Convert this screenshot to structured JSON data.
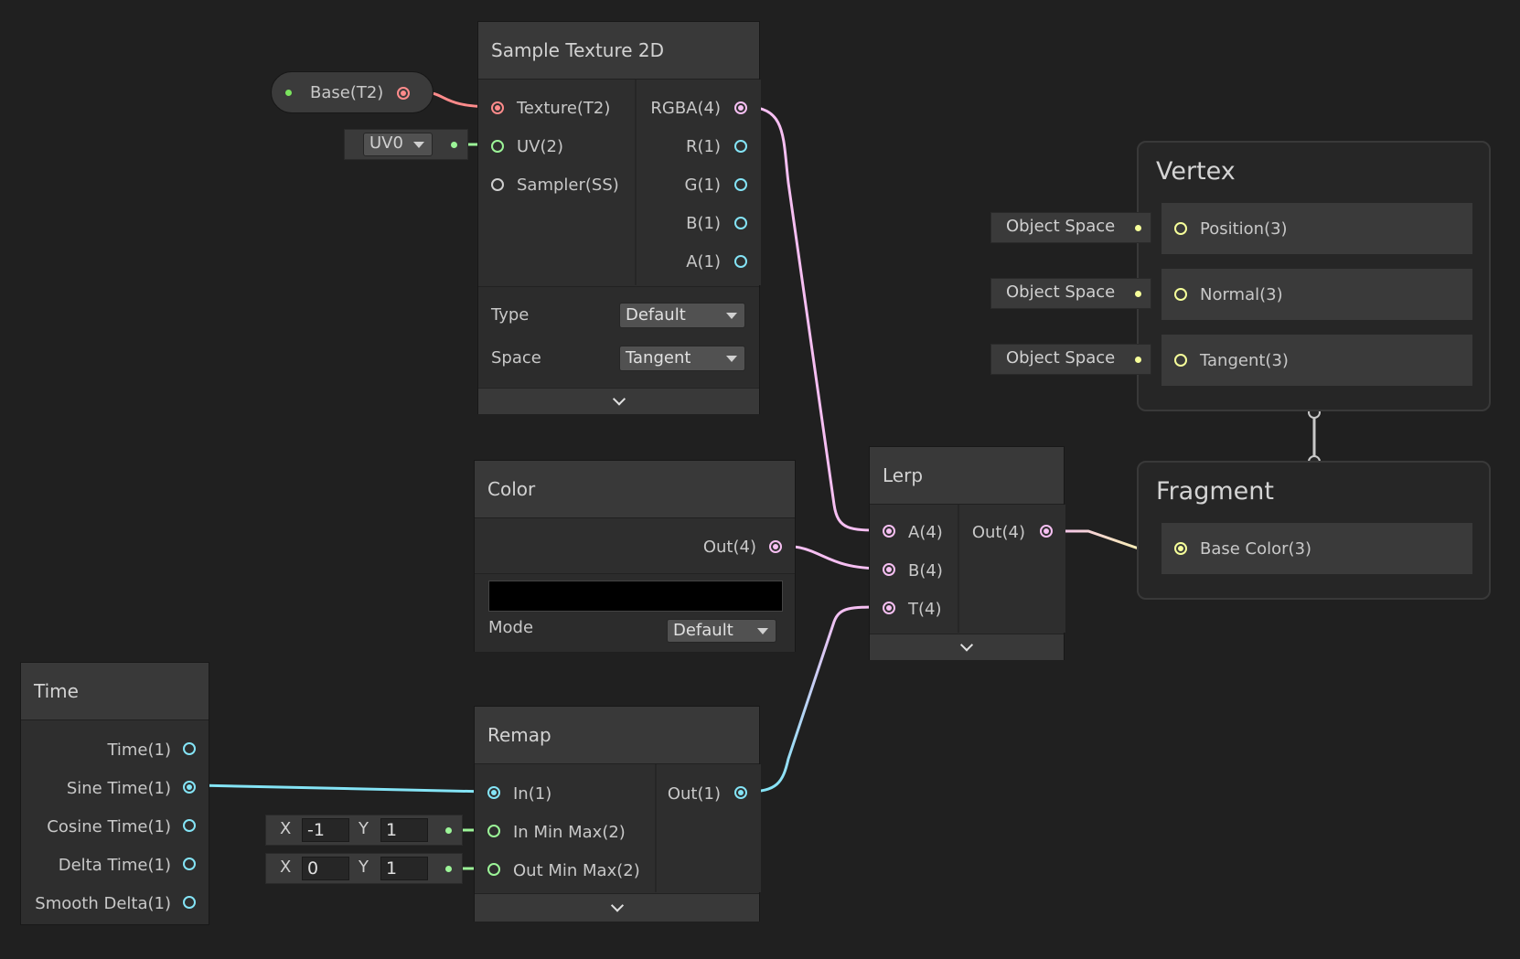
{
  "colors": {
    "background": "#202020",
    "texture_port": "#ff8b8b",
    "vector2_port": "#9cf598",
    "vector4_port": "#f6bff2",
    "vector1_port": "#84e4f6",
    "vector3_port": "#f6ff9a"
  },
  "base_property": {
    "label": "Base(T2)"
  },
  "uv_input": {
    "value": "UV0"
  },
  "sample_texture": {
    "title": "Sample Texture 2D",
    "inputs": [
      "Texture(T2)",
      "UV(2)",
      "Sampler(SS)"
    ],
    "outputs": [
      "RGBA(4)",
      "R(1)",
      "G(1)",
      "B(1)",
      "A(1)"
    ],
    "type_label": "Type",
    "type_value": "Default",
    "space_label": "Space",
    "space_value": "Tangent"
  },
  "color_node": {
    "title": "Color",
    "output": "Out(4)",
    "swatch": "#000000",
    "mode_label": "Mode",
    "mode_value": "Default"
  },
  "time_node": {
    "title": "Time",
    "outputs": [
      "Time(1)",
      "Sine Time(1)",
      "Cosine Time(1)",
      "Delta Time(1)",
      "Smooth Delta(1)"
    ]
  },
  "remap_node": {
    "title": "Remap",
    "inputs": [
      "In(1)",
      "In Min Max(2)",
      "Out Min Max(2)"
    ],
    "output": "Out(1)",
    "in_min_max": {
      "x_label": "X",
      "x": "-1",
      "y_label": "Y",
      "y": "1"
    },
    "out_min_max": {
      "x_label": "X",
      "x": "0",
      "y_label": "Y",
      "y": "1"
    }
  },
  "lerp_node": {
    "title": "Lerp",
    "inputs": [
      "A(4)",
      "B(4)",
      "T(4)"
    ],
    "output": "Out(4)"
  },
  "vertex_context": {
    "title": "Vertex",
    "blocks": [
      "Position(3)",
      "Normal(3)",
      "Tangent(3)"
    ],
    "space_inputs": [
      "Object Space",
      "Object Space",
      "Object Space"
    ]
  },
  "fragment_context": {
    "title": "Fragment",
    "blocks": [
      "Base Color(3)"
    ]
  }
}
